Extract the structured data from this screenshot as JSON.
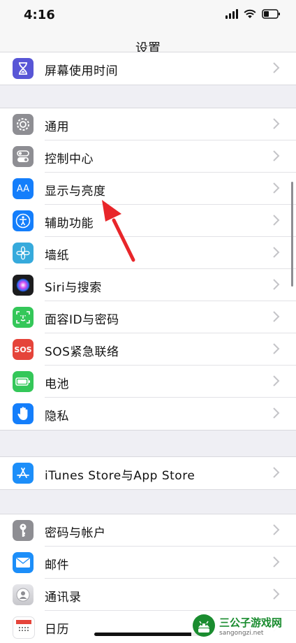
{
  "status": {
    "time": "4:16"
  },
  "nav": {
    "title": "设置"
  },
  "groups": [
    {
      "items": [
        {
          "label": "屏幕使用时间",
          "icon": "hourglass-icon",
          "color": "#5856d6"
        }
      ]
    },
    {
      "items": [
        {
          "label": "通用",
          "icon": "gear-icon",
          "color": "#8e8e93"
        },
        {
          "label": "控制中心",
          "icon": "toggles-icon",
          "color": "#8e8e93"
        },
        {
          "label": "显示与亮度",
          "icon": "text-size-icon",
          "color": "#147efb"
        },
        {
          "label": "辅助功能",
          "icon": "accessibility-icon",
          "color": "#147efb"
        },
        {
          "label": "墙纸",
          "icon": "flower-icon",
          "color": "#36aadc"
        },
        {
          "label": "Siri与搜索",
          "icon": "siri-icon",
          "color": "#1c1c1e"
        },
        {
          "label": "面容ID与密码",
          "icon": "face-id-icon",
          "color": "#34c759"
        },
        {
          "label": "SOS紧急联络",
          "icon": "sos-icon",
          "color": "#e5443a"
        },
        {
          "label": "电池",
          "icon": "battery-icon",
          "color": "#34c759"
        },
        {
          "label": "隐私",
          "icon": "hand-icon",
          "color": "#147efb"
        }
      ]
    },
    {
      "items": [
        {
          "label": "iTunes Store与App Store",
          "icon": "app-store-icon",
          "color": "#1c8ef9"
        }
      ]
    },
    {
      "items": [
        {
          "label": "密码与帐户",
          "icon": "key-icon",
          "color": "#8e8e93"
        },
        {
          "label": "邮件",
          "icon": "mail-icon",
          "color": "#1c8ef9"
        },
        {
          "label": "通讯录",
          "icon": "contacts-icon",
          "color": "#c7c7cc"
        },
        {
          "label": "日历",
          "icon": "calendar-icon",
          "color": "#ffffff"
        }
      ]
    }
  ],
  "sos_icon_text": "SOS",
  "display_icon_text": "AA",
  "watermark": {
    "main": "三公子游戏网",
    "sub": "sangongzi.net"
  },
  "annotation": {
    "arrow_color": "#e8262a"
  }
}
